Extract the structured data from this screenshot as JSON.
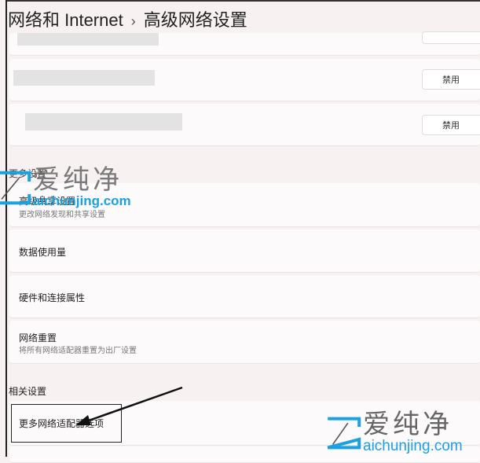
{
  "breadcrumb": {
    "parent": "网络和 Internet",
    "separator": "›",
    "current": "高级网络设置"
  },
  "adapters": [
    {
      "button": "禁用"
    },
    {
      "button": "禁用"
    }
  ],
  "more_settings": {
    "header": "更多设置",
    "items": [
      {
        "label": "高级共享设置",
        "sub": "更改网络发现和共享设置"
      },
      {
        "label": "数据使用量"
      },
      {
        "label": "硬件和连接属性"
      },
      {
        "label": "网络重置",
        "sub": "将所有网络适配器重置为出厂设置"
      }
    ]
  },
  "related": {
    "header": "相关设置",
    "items": [
      {
        "label": "更多网络适配器选项"
      }
    ]
  },
  "watermark": {
    "cn": "爱纯净",
    "en": "aichunjing.com"
  }
}
